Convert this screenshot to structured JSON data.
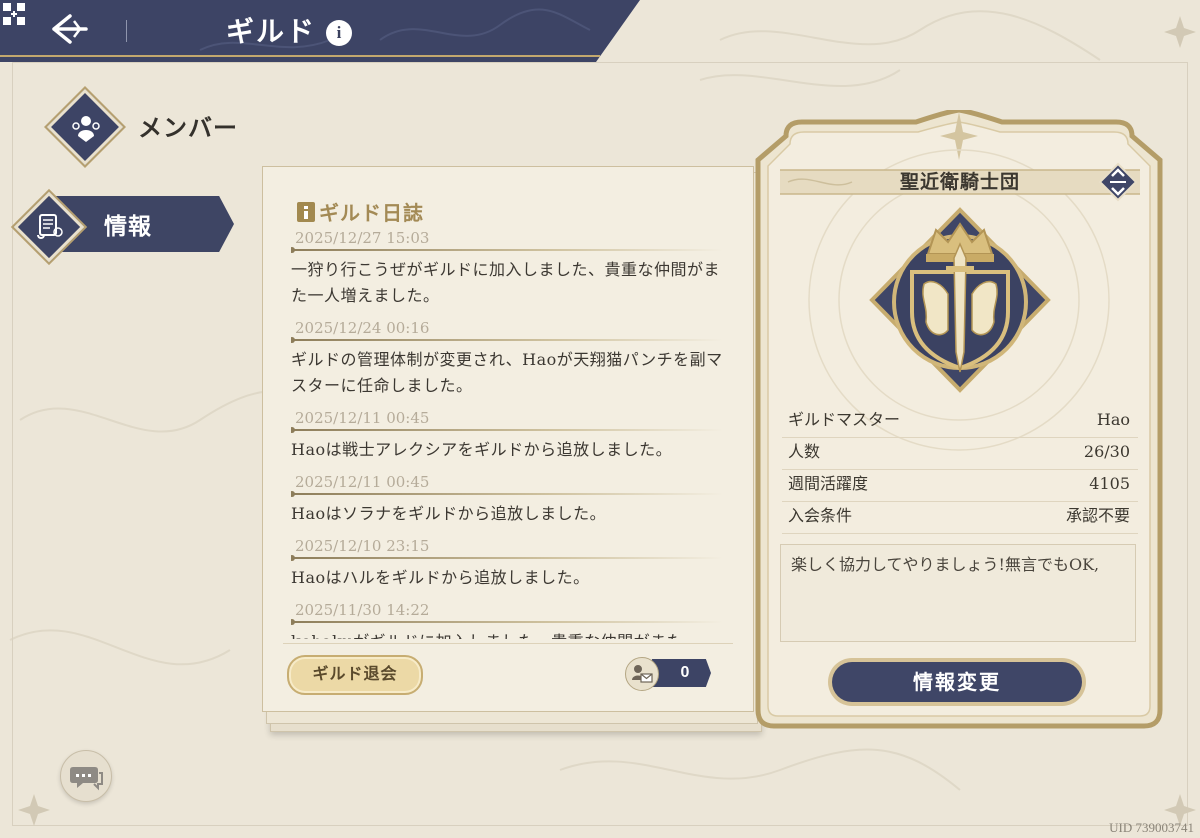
{
  "header": {
    "title": "ギルド",
    "info_symbol": "i",
    "colors": {
      "bar": "#3d4465",
      "text": "#ffffff"
    }
  },
  "nav": {
    "items": [
      {
        "label": "メンバー",
        "icon": "members-icon",
        "active": false
      },
      {
        "label": "情報",
        "icon": "scroll-icon",
        "active": true
      }
    ]
  },
  "log": {
    "title": "ギルド日誌",
    "entries": [
      {
        "date": "2025/12/27 15:03",
        "text": "一狩り行こうぜがギルドに加入しました、貴重な仲間がまた一人増えました。"
      },
      {
        "date": "2025/12/24 00:16",
        "text": "ギルドの管理体制が変更され、Haoが天翔猫パンチを副マスターに任命しました。"
      },
      {
        "date": "2025/12/11 00:45",
        "text": "Haoは戦士アレクシアをギルドから追放しました。"
      },
      {
        "date": "2025/12/11 00:45",
        "text": "Haoはソラナをギルドから追放しました。"
      },
      {
        "date": "2025/12/10 23:15",
        "text": "Haoはハルをギルドから追放しました。"
      },
      {
        "date": "2025/11/30 14:22",
        "text": "kohakuがギルドに加入しました、貴重な仲間がまた"
      }
    ],
    "leave_button": "ギルド退会",
    "request_count": "0"
  },
  "guild": {
    "name": "聖近衛騎士団",
    "stats": [
      {
        "label": "ギルドマスター",
        "value": "Hao"
      },
      {
        "label": "人数",
        "value": "26/30"
      },
      {
        "label": "週間活躍度",
        "value": "4105"
      },
      {
        "label": "入会条件",
        "value": "承認不要"
      }
    ],
    "motto": "楽しく協力してやりましょう!無言でもOK,",
    "edit_button": "情報変更"
  },
  "uid": "UID 739003741"
}
